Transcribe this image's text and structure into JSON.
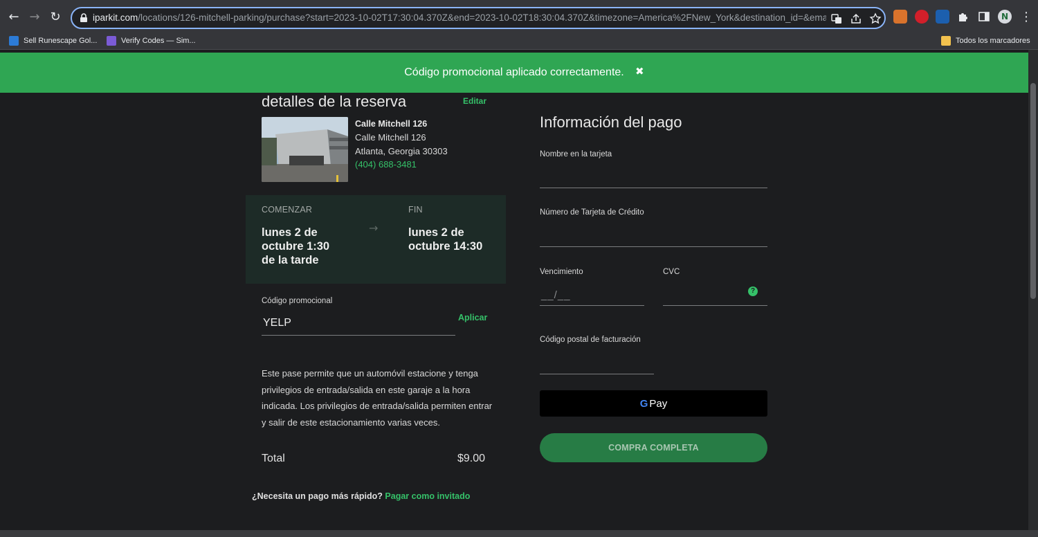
{
  "browser": {
    "url_host": "iparkit.com",
    "url_path": "/locations/126-mitchell-parking/purchase?start=2023-10-02T17:30:04.370Z&end=2023-10-02T18:30:04.370Z&timezone=America%2FNew_York&destination_id=&email=",
    "back_icon": "←",
    "forward_icon": "→",
    "reload_icon": "↻",
    "menu_icon": "⋮",
    "profile_initial": "N"
  },
  "bookmarks": {
    "items": [
      {
        "label": "Sell Runescape Gol..."
      },
      {
        "label": "Verify Codes — Sim..."
      }
    ],
    "all_bookmarks": "Todos los marcadores"
  },
  "banner": {
    "message": "Código promocional aplicado correctamente.",
    "close": "✖"
  },
  "reservation": {
    "heading": "detalles de la reserva",
    "edit": "Editar",
    "location_name": "Calle Mitchell 126",
    "address_line1": "Calle Mitchell 126",
    "address_line2": "Atlanta, Georgia 30303",
    "phone": "(404) 688-3481",
    "start_label": "COMENZAR",
    "start_value": "lunes 2 de octubre 1:30 de la tarde",
    "arrow": "→",
    "end_label": "FIN",
    "end_value": "lunes 2 de octubre 14:30",
    "promo_label": "Código promocional",
    "promo_value": "YELP",
    "apply": "Aplicar",
    "description": "Este pase permite que un automóvil estacione y tenga privilegios de entrada/salida en este garaje a la hora indicada. Los privilegios de entrada/salida permiten entrar y salir de este estacionamiento varias veces.",
    "total_label": "Total",
    "total_value": "$9.00",
    "faster_text": "¿Necesita un pago más rápido?",
    "guest_link": "Pagar como invitado"
  },
  "payment": {
    "title": "Información del pago",
    "name_label": "Nombre en la tarjeta",
    "card_label": "Número de Tarjeta de Crédito",
    "expiry_label": "Vencimiento",
    "expiry_placeholder": "__/__",
    "cvc_label": "CVC",
    "help": "?",
    "postal_label": "Código postal de facturación",
    "gpay_g": "G",
    "gpay_text": "Pay",
    "buy_button": "COMPRA COMPLETA"
  },
  "colors": {
    "accent_green": "#35c169",
    "banner_green": "#2fa653",
    "button_green": "#277c45",
    "background": "#1c1d1f"
  }
}
